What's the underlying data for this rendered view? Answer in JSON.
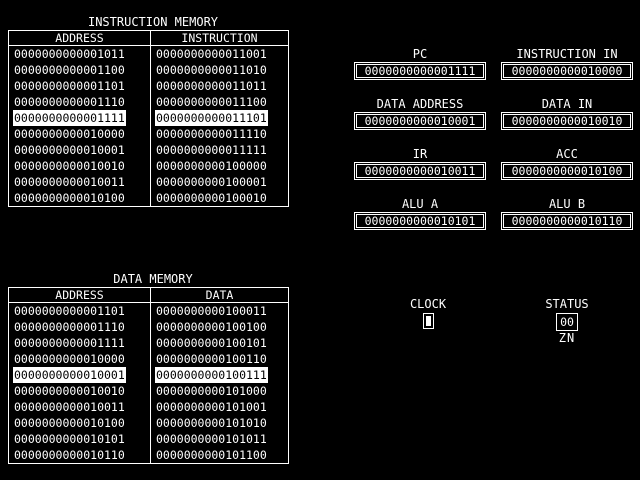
{
  "instruction_memory": {
    "title": "INSTRUCTION MEMORY",
    "headers": [
      "ADDRESS",
      "INSTRUCTION"
    ],
    "highlight_row": 4,
    "rows": [
      [
        "0000000000001011",
        "0000000000011001"
      ],
      [
        "0000000000001100",
        "0000000000011010"
      ],
      [
        "0000000000001101",
        "0000000000011011"
      ],
      [
        "0000000000001110",
        "0000000000011100"
      ],
      [
        "0000000000001111",
        "0000000000011101"
      ],
      [
        "0000000000010000",
        "0000000000011110"
      ],
      [
        "0000000000010001",
        "0000000000011111"
      ],
      [
        "0000000000010010",
        "0000000000100000"
      ],
      [
        "0000000000010011",
        "0000000000100001"
      ],
      [
        "0000000000010100",
        "0000000000100010"
      ]
    ]
  },
  "data_memory": {
    "title": "DATA MEMORY",
    "headers": [
      "ADDRESS",
      "DATA"
    ],
    "highlight_row": 4,
    "rows": [
      [
        "0000000000001101",
        "0000000000100011"
      ],
      [
        "0000000000001110",
        "0000000000100100"
      ],
      [
        "0000000000001111",
        "0000000000100101"
      ],
      [
        "0000000000010000",
        "0000000000100110"
      ],
      [
        "0000000000010001",
        "0000000000100111"
      ],
      [
        "0000000000010010",
        "0000000000101000"
      ],
      [
        "0000000000010011",
        "0000000000101001"
      ],
      [
        "0000000000010100",
        "0000000000101010"
      ],
      [
        "0000000000010101",
        "0000000000101011"
      ],
      [
        "0000000000010110",
        "0000000000101100"
      ]
    ]
  },
  "registers": {
    "pc": {
      "label": "PC",
      "value": "0000000000001111"
    },
    "instruction_in": {
      "label": "INSTRUCTION IN",
      "value": "0000000000010000"
    },
    "data_address": {
      "label": "DATA ADDRESS",
      "value": "0000000000010001"
    },
    "data_in": {
      "label": "DATA IN",
      "value": "0000000000010010"
    },
    "ir": {
      "label": "IR",
      "value": "0000000000010011"
    },
    "acc": {
      "label": "ACC",
      "value": "0000000000010100"
    },
    "alu_a": {
      "label": "ALU A",
      "value": "0000000000010101"
    },
    "alu_b": {
      "label": "ALU B",
      "value": "0000000000010110"
    }
  },
  "clock": {
    "label": "CLOCK",
    "state": "high"
  },
  "status": {
    "label": "STATUS",
    "value": "00",
    "flags": "ZN"
  }
}
